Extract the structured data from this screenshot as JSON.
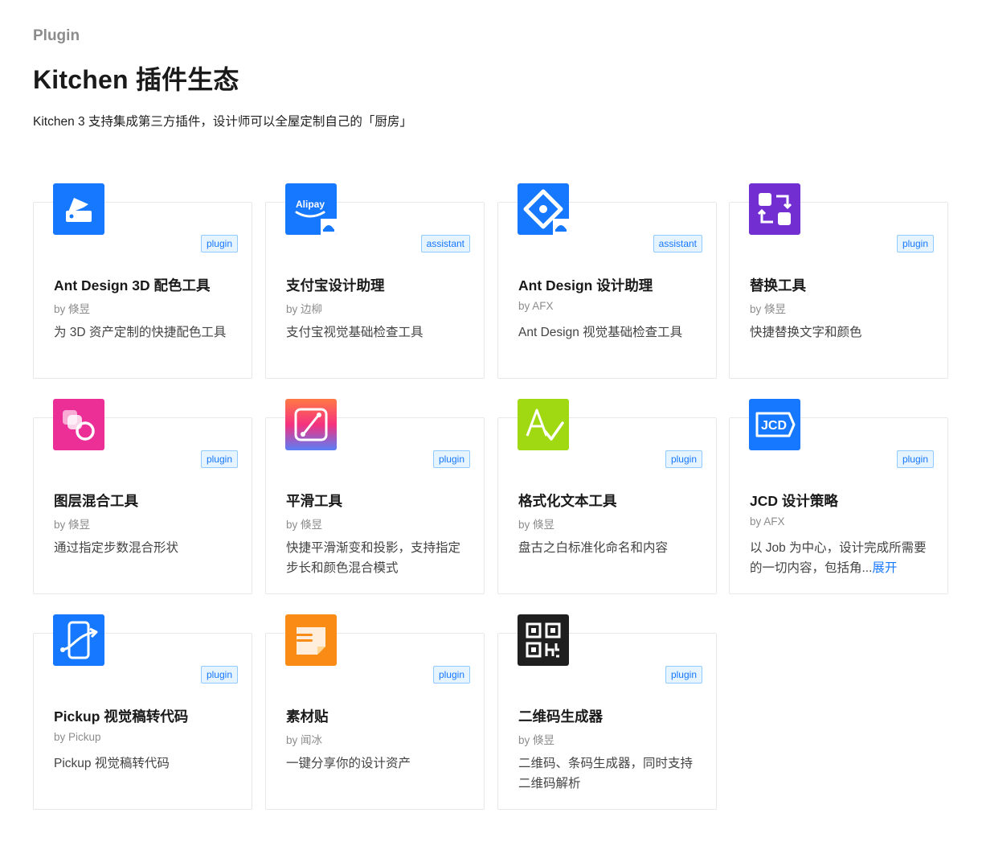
{
  "header": {
    "eyebrow": "Plugin",
    "title": "Kitchen 插件生态",
    "subtitle": "Kitchen 3 支持集成第三方插件，设计师可以全屋定制自己的「厨房」"
  },
  "colors": {
    "tag_text": "#1677ff",
    "tag_bg": "#e6f4ff",
    "tag_border": "#91caff",
    "link": "#1677ff"
  },
  "cards": [
    {
      "icon": "ant-design-3d-icon",
      "tag": "plugin",
      "name": "Ant Design 3D 配色工具",
      "author": "by 倏昱",
      "desc": "为 3D 资产定制的快捷配色工具"
    },
    {
      "icon": "alipay-icon",
      "tag": "assistant",
      "name": "支付宝设计助理",
      "author": "by 边柳",
      "desc": "支付宝视觉基础检查工具"
    },
    {
      "icon": "ant-design-logo-icon",
      "tag": "assistant",
      "name": "Ant Design 设计助理",
      "author": "by AFX",
      "desc": "Ant Design 视觉基础检查工具"
    },
    {
      "icon": "swap-icon",
      "tag": "plugin",
      "name": "替换工具",
      "author": "by 倏昱",
      "desc": "快捷替换文字和颜色"
    },
    {
      "icon": "layer-blend-icon",
      "tag": "plugin",
      "name": "图层混合工具",
      "author": "by 倏昱",
      "desc": "通过指定步数混合形状"
    },
    {
      "icon": "smooth-icon",
      "tag": "plugin",
      "name": "平滑工具",
      "author": "by 倏昱",
      "desc": "快捷平滑渐变和投影，支持指定步长和颜色混合模式"
    },
    {
      "icon": "text-format-icon",
      "tag": "plugin",
      "name": "格式化文本工具",
      "author": "by 倏昱",
      "desc": "盘古之白标准化命名和内容"
    },
    {
      "icon": "jcd-icon",
      "tag": "plugin",
      "name": "JCD 设计策略",
      "author": "by AFX",
      "desc": "以 Job 为中心，设计完成所需要的一切内容，包括角...",
      "more": "展开"
    },
    {
      "icon": "pickup-icon",
      "tag": "plugin",
      "name": "Pickup 视觉稿转代码",
      "author": "by Pickup",
      "desc": "Pickup 视觉稿转代码"
    },
    {
      "icon": "sticker-icon",
      "tag": "plugin",
      "name": "素材贴",
      "author": "by 闻冰",
      "desc": "一键分享你的设计资产"
    },
    {
      "icon": "qrcode-icon",
      "tag": "plugin",
      "name": "二维码生成器",
      "author": "by 倏昱",
      "desc": "二维码、条码生成器，同时支持二维码解析"
    }
  ]
}
